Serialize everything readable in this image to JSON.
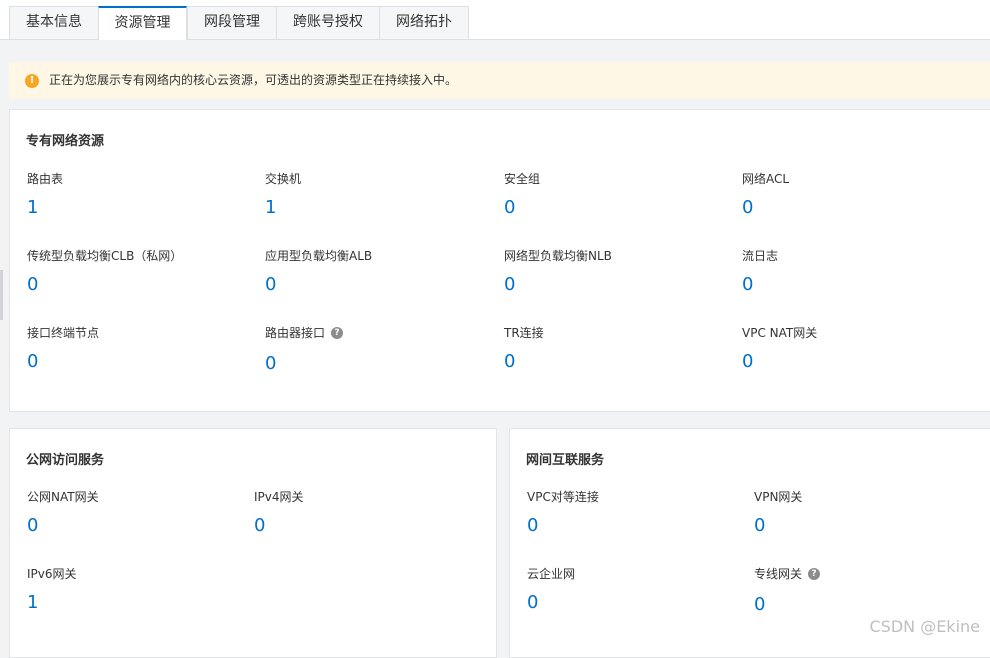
{
  "tabs": [
    {
      "label": "基本信息"
    },
    {
      "label": "资源管理"
    },
    {
      "label": "网段管理"
    },
    {
      "label": "跨账号授权"
    },
    {
      "label": "网络拓扑"
    }
  ],
  "notice": {
    "icon": "warning-icon",
    "text": "正在为您展示专有网络内的核心云资源，可透出的资源类型正在持续接入中。"
  },
  "vpc_resources": {
    "title": "专有网络资源",
    "items": [
      {
        "label": "路由表",
        "value": "1"
      },
      {
        "label": "交换机",
        "value": "1"
      },
      {
        "label": "安全组",
        "value": "0"
      },
      {
        "label": "网络ACL",
        "value": "0"
      },
      {
        "label": "传统型负载均衡CLB（私网）",
        "value": "0"
      },
      {
        "label": "应用型负载均衡ALB",
        "value": "0"
      },
      {
        "label": "网络型负载均衡NLB",
        "value": "0"
      },
      {
        "label": "流日志",
        "value": "0"
      },
      {
        "label": "接口终端节点",
        "value": "0"
      },
      {
        "label": "路由器接口",
        "value": "0"
      },
      {
        "label": "TR连接",
        "value": "0"
      },
      {
        "label": "VPC NAT网关",
        "value": "0"
      }
    ]
  },
  "public_access": {
    "title": "公网访问服务",
    "items": [
      {
        "label": "公网NAT网关",
        "value": "0"
      },
      {
        "label": "IPv4网关",
        "value": "0"
      },
      {
        "label": "IPv6网关",
        "value": "1"
      }
    ]
  },
  "interconnect": {
    "title": "网间互联服务",
    "items": [
      {
        "label": "VPC对等连接",
        "value": "0"
      },
      {
        "label": "VPN网关",
        "value": "0"
      },
      {
        "label": "云企业网",
        "value": "0"
      },
      {
        "label": "专线网关",
        "value": "0"
      }
    ]
  },
  "watermark": "CSDN @Ekine",
  "colors": {
    "accent": "#0070cc",
    "notice_bg": "#fff7e6",
    "warning": "#f5a623"
  }
}
